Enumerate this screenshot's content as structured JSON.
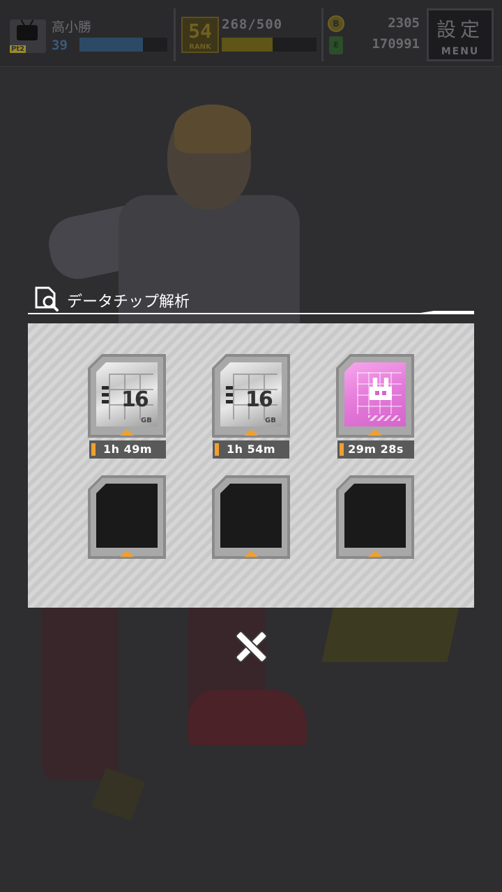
{
  "header": {
    "player_name": "高小勝",
    "player_level": "39",
    "exp_fraction": 0.72,
    "tv_tag": "Pt2",
    "rank_number": "54",
    "rank_label": "RANK",
    "stamina": "268/500",
    "stamina_fraction": 0.536,
    "coins": "2305",
    "coin_icon": "B",
    "gems": "170991",
    "gem_icon": "E",
    "menu_kanji": "設定",
    "menu_label": "MENU"
  },
  "dialog": {
    "title": "データチップ解析",
    "icon": "document-search-icon",
    "slots": [
      {
        "state": "filled",
        "chip": "silver",
        "capacity": "16",
        "unit": "GB",
        "timer": "1h 49m"
      },
      {
        "state": "filled",
        "chip": "silver",
        "capacity": "16",
        "unit": "GB",
        "timer": "1h 54m"
      },
      {
        "state": "filled",
        "chip": "pink",
        "timer": "29m 28s"
      },
      {
        "state": "empty"
      },
      {
        "state": "empty"
      },
      {
        "state": "empty"
      }
    ]
  },
  "colors": {
    "accent_orange": "#f0a030",
    "chip_pink": "#e47ad9",
    "panel_bg": "#cfcfcf"
  }
}
